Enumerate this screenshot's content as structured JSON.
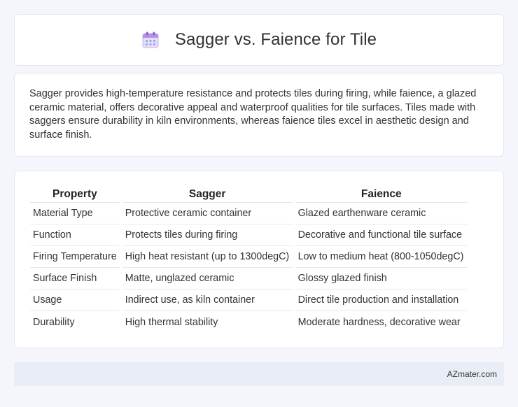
{
  "header": {
    "title": "Sagger vs. Faience for Tile",
    "icon": "calendar-icon"
  },
  "summary": {
    "text": "Sagger provides high-temperature resistance and protects tiles during firing, while faience, a glazed ceramic material, offers decorative appeal and waterproof qualities for tile surfaces. Tiles made with saggers ensure durability in kiln environments, whereas faience tiles excel in aesthetic design and surface finish."
  },
  "table": {
    "headers": [
      "Property",
      "Sagger",
      "Faience"
    ],
    "rows": [
      [
        "Material Type",
        "Protective ceramic container",
        "Glazed earthenware ceramic"
      ],
      [
        "Function",
        "Protects tiles during firing",
        "Decorative and functional tile surface"
      ],
      [
        "Firing Temperature",
        "High heat resistant (up to 1300degC)",
        "Low to medium heat (800-1050degC)"
      ],
      [
        "Surface Finish",
        "Matte, unglazed ceramic",
        "Glossy glazed finish"
      ],
      [
        "Usage",
        "Indirect use, as kiln container",
        "Direct tile production and installation"
      ],
      [
        "Durability",
        "High thermal stability",
        "Moderate hardness, decorative wear"
      ]
    ]
  },
  "footer": {
    "brand": "AZmater.com"
  }
}
